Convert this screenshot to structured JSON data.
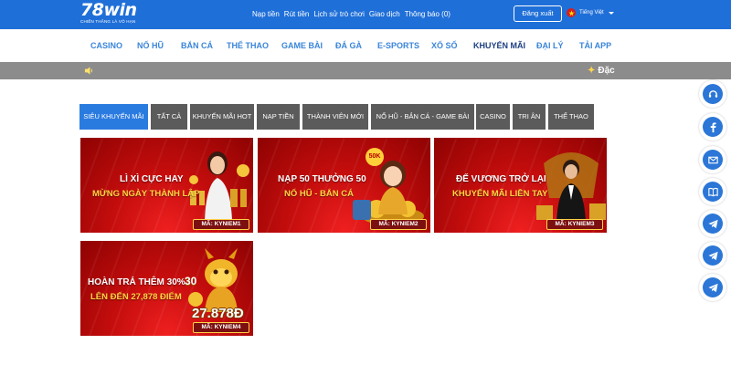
{
  "brand": {
    "logo": "78win",
    "slogan": "CHIẾN THẮNG LÀ VÔ HẠN"
  },
  "header": {
    "links": [
      "Nạp tiền",
      "Rút tiền",
      "Lịch sử trò chơi",
      "Giao dịch",
      "Thông báo (0)"
    ],
    "logout_label": "Đăng xuất",
    "language": "Tiếng Việt"
  },
  "nav": {
    "items": [
      "CASINO",
      "NỔ HŨ",
      "BẮN CÁ",
      "THỂ THAO",
      "GAME BÀI",
      "ĐÁ GÀ",
      "E-SPORTS",
      "XỔ SỐ",
      "KHUYẾN MÃI",
      "ĐẠI LÝ",
      "TẢI APP"
    ],
    "active": "KHUYẾN MÃI"
  },
  "marquee": {
    "text": "Đặc"
  },
  "tabs": {
    "items": [
      "SIÊU KHUYẾN MÃI",
      "TẤT CẢ",
      "KHUYẾN MÃI HOT",
      "NẠP TIỀN",
      "THÀNH VIÊN MỚI",
      "NỔ HŨ - BẮN CÁ - GAME BÀI",
      "CASINO",
      "TRI ÂN",
      "THỂ THAO"
    ],
    "active": "SIÊU KHUYẾN MÃI"
  },
  "promos": [
    {
      "line1": "LÌ XÌ CỰC HAY",
      "line2": "MỪNG NGÀY THÀNH LẬP",
      "code": "MÃ: KYNIEM1"
    },
    {
      "line1": "NẠP 50 THƯỞNG 50",
      "line2": "NỔ HŨ - BẮN CÁ",
      "code": "MÃ: KYNIEM2",
      "badge": "50K"
    },
    {
      "line1": "ĐẾ VƯƠNG TRỞ LẠI",
      "line2": "KHUYẾN MÃI LIỀN TAY",
      "code": "MÃ: KYNIEM3"
    },
    {
      "line1": "HOÀN TRẢ THÊM 30%",
      "line2": "LÊN ĐẾN 27,878 ĐIỂM",
      "code": "MÃ: KYNIEM4",
      "badge": "30",
      "amount": "27.878Đ"
    }
  ],
  "side_buttons": [
    "support-chat-icon",
    "facebook-icon",
    "email-icon",
    "guide-book-icon",
    "telegram-icon",
    "telegram-icon",
    "telegram-icon"
  ],
  "colors": {
    "header_blue": "#1f6fd8",
    "nav_text": "#3a85d9",
    "nav_active": "#1c3e80",
    "tab_active": "#2a7be0",
    "tab_default": "#5b5b5b",
    "marquee_bar": "#8c8c8c",
    "promo_red": "#c50d0d",
    "promo_gold": "#ffd642"
  }
}
